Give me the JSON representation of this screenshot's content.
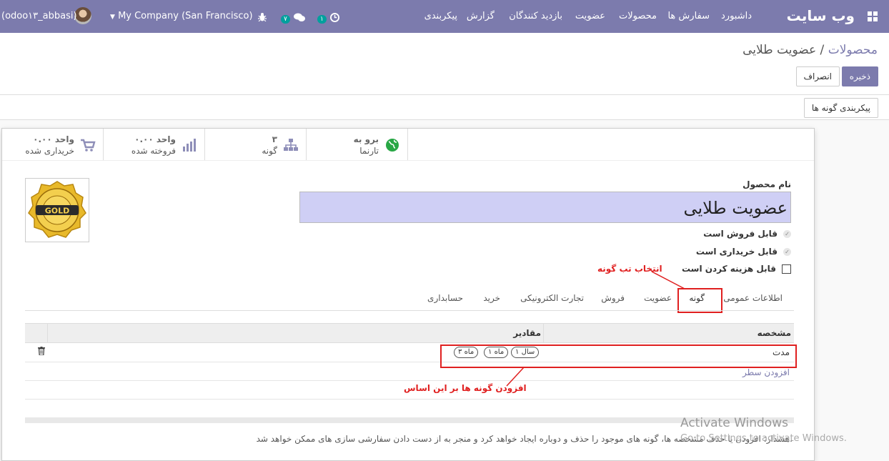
{
  "navbar": {
    "brand": "وب سایت",
    "menu": [
      "داشبورد",
      "سفارش ها",
      "محصولات",
      "عضویت",
      "بازدید کنندگان",
      "گزارش",
      "پیکربندی"
    ],
    "activity_count": "۱",
    "messages_count": "۷",
    "company": "My Company (San Francisco)",
    "user": "(odoo۱۳_abbasi)"
  },
  "control_panel": {
    "breadcrumb_parent": "محصولات",
    "breadcrumb_sep": " / ",
    "breadcrumb_current": "عضویت طلایی",
    "save": "ذخیره",
    "discard": "انصراف",
    "configure_variants": "پیکربندی گونه ها"
  },
  "stats": {
    "website": {
      "value": "برو به",
      "label": "تارنما"
    },
    "variants": {
      "value": "۳",
      "label": "گونه"
    },
    "sold": {
      "value": "۰.۰۰ واحد",
      "label": "فروخته شده"
    },
    "purchased": {
      "value": "۰.۰۰ واحد",
      "label": "خریداری شده"
    }
  },
  "form": {
    "name_label": "نام محصول",
    "name_value": "عضویت طلایی",
    "can_be_sold": "قابل فروش است",
    "can_be_purchased": "قابل خریداری است",
    "can_be_expensed": "قابل هزینه کردن است",
    "logo_text": "GOLD"
  },
  "tabs": [
    "اطلاعات عمومی",
    "گونه",
    "عضویت",
    "فروش",
    "تجارت الکترونیکی",
    "خرید",
    "حسابداری"
  ],
  "table": {
    "col_attribute": "مشخصه",
    "col_values": "مقادیر",
    "row": {
      "attribute": "مدت",
      "values": [
        "۱ سال",
        "۱ ماه",
        "۳ ماه"
      ]
    },
    "add_line": "افزودن سطر"
  },
  "note": "هشدار: افزودن یا حذف مشخصه ها، گونه های موجود را حذف و دوباره ایجاد خواهد کرد و منجر به از دست دادن سفارشی سازی های ممکن خواهد شد.",
  "annotations": {
    "select_tab": "انتخاب تب گونه",
    "add_variants": "افزودن گونه ها بر این اساس"
  },
  "watermark": {
    "line1": "Activate Windows",
    "line2": "Go to Settings to activate Windows."
  },
  "colors": {
    "brand": "#7c7bad",
    "annotation": "#e02020",
    "name_bg": "#cfcff5"
  }
}
